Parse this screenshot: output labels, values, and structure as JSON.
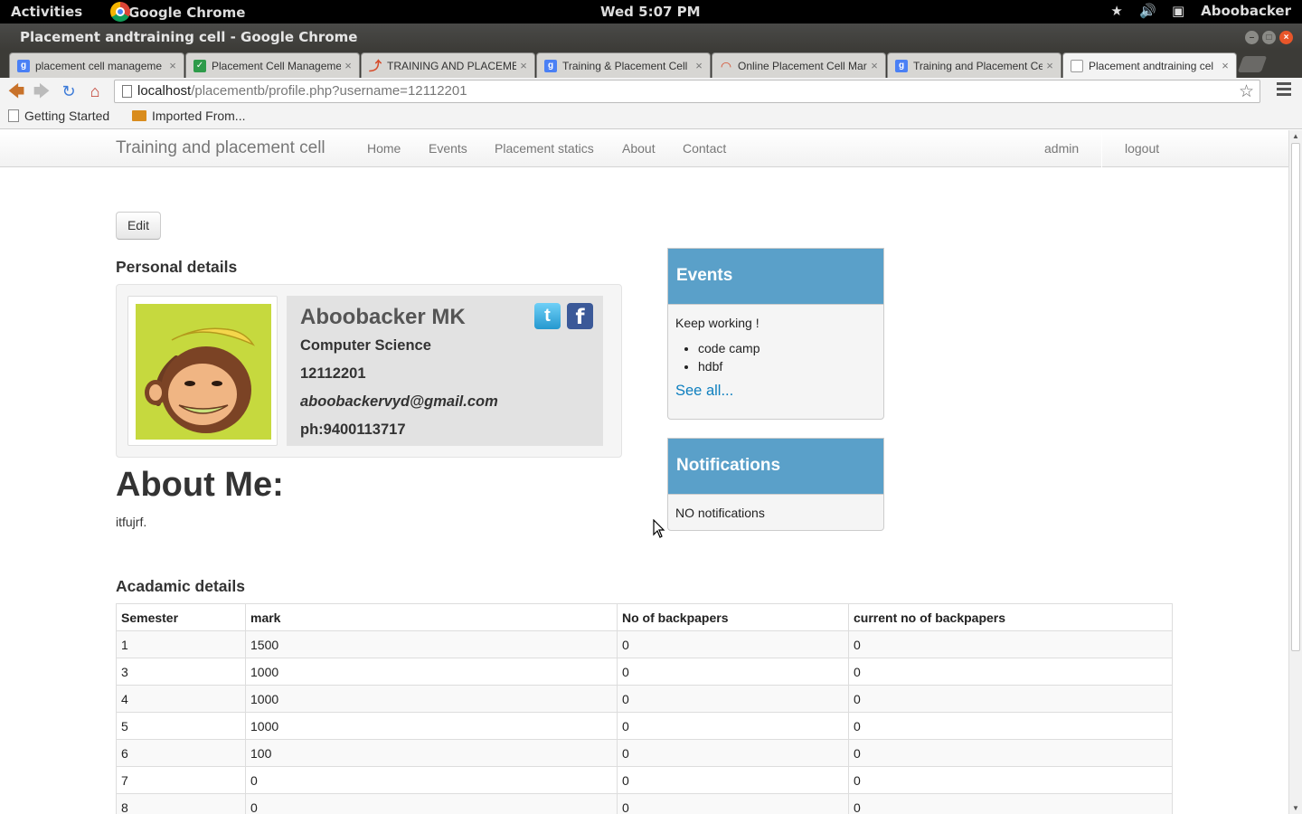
{
  "system_bar": {
    "activities": "Activities",
    "app_name": "Google Chrome",
    "clock": "Wed  5:07 PM",
    "user": "Aboobacker"
  },
  "window": {
    "title": "Placement andtraining cell - Google Chrome"
  },
  "tabs": [
    {
      "label": "placement cell manageme",
      "icon": "google-icon"
    },
    {
      "label": "Placement Cell Manageme",
      "icon": "doc-icon"
    },
    {
      "label": "TRAINING AND PLACEMEN",
      "icon": "red-favicon"
    },
    {
      "label": "Training & Placement Cell",
      "icon": "google-icon"
    },
    {
      "label": "Online Placement Cell Mar",
      "icon": "loading-icon"
    },
    {
      "label": "Training and Placement Ce",
      "icon": "google-icon"
    },
    {
      "label": "Placement andtraining cel",
      "icon": "page-icon",
      "active": true
    }
  ],
  "omnibox": {
    "host": "localhost",
    "path": "/placementb/profile.php?username=12112201"
  },
  "bookmarks": [
    {
      "label": "Getting Started"
    },
    {
      "label": "Imported From..."
    }
  ],
  "navbar": {
    "brand": "Training and placement cell",
    "links": [
      "Home",
      "Events",
      "Placement statics",
      "About",
      "Contact"
    ],
    "right_links": [
      "admin",
      "logout"
    ]
  },
  "profile": {
    "edit_label": "Edit",
    "personal_heading": "Personal details",
    "name": "Aboobacker MK",
    "department": "Computer Science",
    "reg_no": "12112201",
    "email": "aboobackervyd@gmail.com",
    "phone": "ph:9400113717",
    "about_heading": "About Me:",
    "about_text": "itfujrf."
  },
  "events_panel": {
    "title": "Events",
    "intro": "Keep working !",
    "items": [
      "code camp",
      "hdbf"
    ],
    "see_all": "See all..."
  },
  "notifications_panel": {
    "title": "Notifications",
    "text": "NO notifications"
  },
  "academic": {
    "heading": "Acadamic details",
    "columns": [
      "Semester",
      "mark",
      "No of backpapers",
      "current no of backpapers"
    ],
    "rows": [
      [
        "1",
        "1500",
        "0",
        "0"
      ],
      [
        "3",
        "1000",
        "0",
        "0"
      ],
      [
        "4",
        "1000",
        "0",
        "0"
      ],
      [
        "5",
        "1000",
        "0",
        "0"
      ],
      [
        "6",
        "100",
        "0",
        "0"
      ],
      [
        "7",
        "0",
        "0",
        "0"
      ],
      [
        "8",
        "0",
        "0",
        "0"
      ]
    ]
  }
}
